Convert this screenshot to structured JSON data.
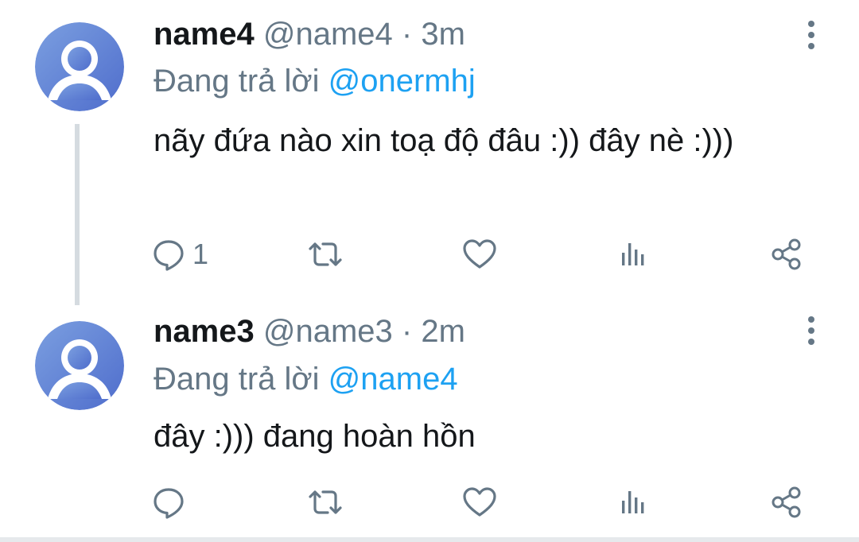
{
  "tweets": [
    {
      "name": "name4",
      "handle": "@name4",
      "separator": "·",
      "time": "3m",
      "reply_label": "Đang trả lời",
      "reply_to": "@onermhj",
      "text": "nãy đứa nào xin toạ độ đâu :)) đây nè :)))",
      "reply_count": "1"
    },
    {
      "name": "name3",
      "handle": "@name3",
      "separator": "·",
      "time": "2m",
      "reply_label": "Đang trả lời",
      "reply_to": "@name4",
      "text": "đây :))) đang hoàn hồn",
      "reply_count": ""
    }
  ],
  "colors": {
    "text_primary": "#14171a",
    "text_secondary": "#657786",
    "mention": "#1da1f2",
    "avatar_gradient_start": "#6a8fd8",
    "avatar_gradient_end": "#4f6fcf",
    "thread_line": "#d5dbe0"
  },
  "icons": {
    "avatar": "default-user-avatar-icon",
    "more": "vertical-ellipsis-icon",
    "reply": "speech-bubble-icon",
    "retweet": "retweet-icon",
    "like": "heart-icon",
    "views": "bar-chart-icon",
    "share": "share-icon"
  }
}
